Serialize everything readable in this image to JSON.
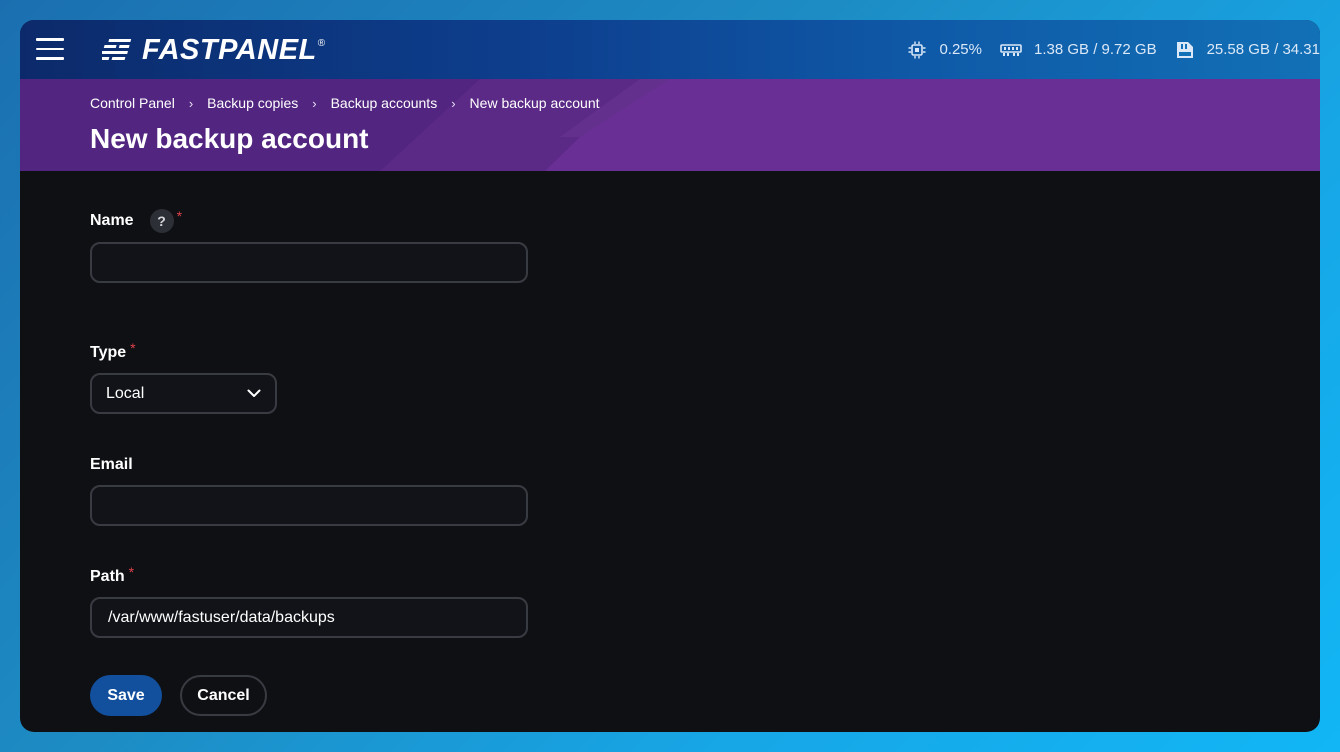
{
  "app": {
    "logo_text": "FASTPANEL",
    "logo_reg": "®"
  },
  "stats": {
    "cpu": "0.25%",
    "ram": "1.38 GB / 9.72 GB",
    "disk": "25.58 GB / 34.31"
  },
  "breadcrumb": [
    "Control Panel",
    "Backup copies",
    "Backup accounts",
    "New backup account"
  ],
  "page_title": "New backup account",
  "form": {
    "name": {
      "label": "Name",
      "help": "?",
      "required_mark": "*",
      "value": ""
    },
    "type": {
      "label": "Type",
      "required_mark": "*",
      "value": "Local"
    },
    "email": {
      "label": "Email",
      "value": ""
    },
    "path": {
      "label": "Path",
      "required_mark": "*",
      "value": "/var/www/fastuser/data/backups"
    }
  },
  "buttons": {
    "save": "Save",
    "cancel": "Cancel"
  },
  "colors": {
    "topbar": "#0d3f8e",
    "header": "#6a2f95",
    "background": "#0f1014",
    "save_button": "#12509e",
    "required": "#e0414a"
  },
  "icons": {
    "menu": "hamburger-icon",
    "cpu": "cpu-icon",
    "ram": "memory-icon",
    "disk": "disk-icon",
    "dropdown": "chevron-down-icon"
  }
}
